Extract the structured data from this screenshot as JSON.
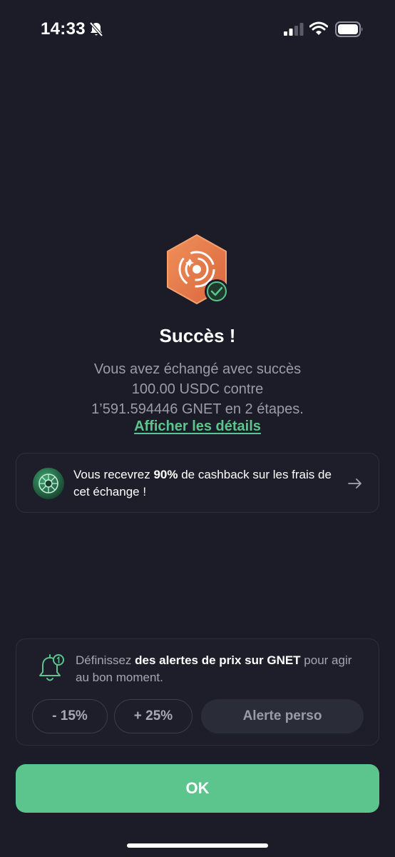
{
  "status_bar": {
    "time": "14:33",
    "icons": [
      "bell-slash-icon",
      "signal-icon",
      "wifi-icon",
      "battery-icon"
    ]
  },
  "hero": {
    "icon": "gnet-token-badge-icon",
    "check_icon": "check-circle-icon",
    "title": "Succès !",
    "message_line1": "Vous avez échangé avec succès",
    "message_line2": "100.00 USDC contre",
    "message_line3": "1’591.594446 GNET en 2 étapes.",
    "details_link": "Afficher les détails"
  },
  "cashback": {
    "text_before": "Vous recevrez ",
    "percent": "90%",
    "text_after": " de cashback sur les frais de cet échange !",
    "icon": "cashback-coin-icon",
    "arrow_icon": "arrow-right-icon"
  },
  "alerts": {
    "icon": "bell-alert-icon",
    "text_before": "Définissez ",
    "text_bold": "des alertes de prix sur GNET",
    "text_after": " pour agir au bon moment.",
    "chips": {
      "minus": "- 15%",
      "plus": "+ 25%",
      "custom": "Alerte perso"
    }
  },
  "ok_label": "OK",
  "colors": {
    "background": "#1b1c27",
    "accent": "#5cc58d",
    "card_border": "#2d2f3c",
    "badge_orange": "#e8794a"
  }
}
